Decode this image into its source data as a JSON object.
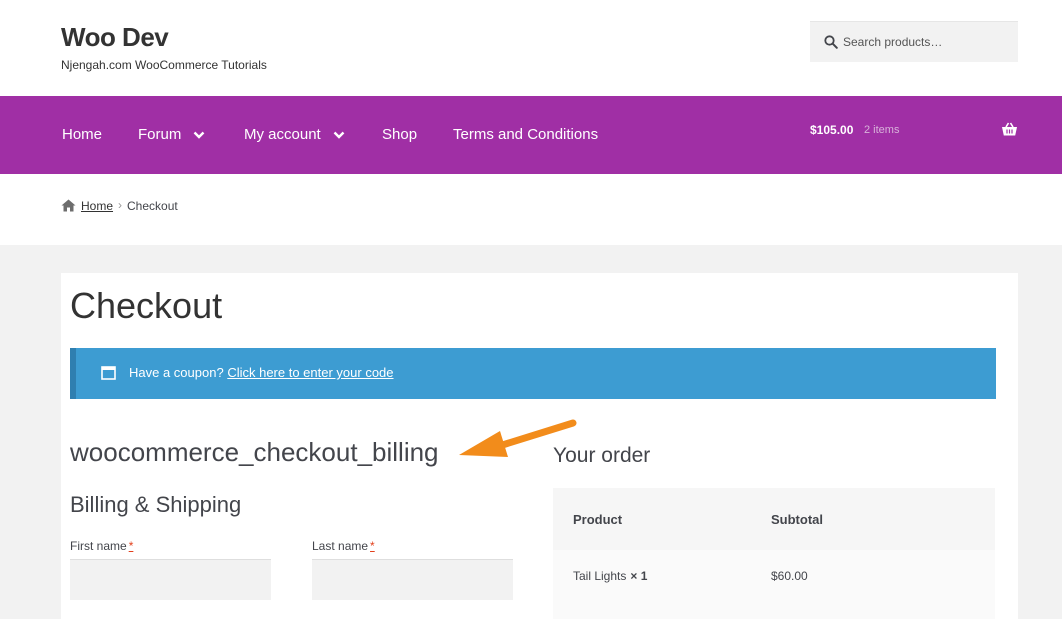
{
  "site": {
    "title": "Woo Dev",
    "description": "Njengah.com WooCommerce Tutorials"
  },
  "search": {
    "placeholder": "Search products…"
  },
  "nav": {
    "items": [
      {
        "label": "Home",
        "has_dropdown": false
      },
      {
        "label": "Forum",
        "has_dropdown": true
      },
      {
        "label": "My account",
        "has_dropdown": true
      },
      {
        "label": "Shop",
        "has_dropdown": false
      },
      {
        "label": "Terms and Conditions",
        "has_dropdown": false
      }
    ]
  },
  "cart": {
    "total": "$105.00",
    "count": "2 items"
  },
  "breadcrumb": {
    "home": "Home",
    "separator": "›",
    "current": "Checkout"
  },
  "page": {
    "title": "Checkout"
  },
  "coupon": {
    "prompt": "Have a coupon?",
    "link": "Click here to enter your code"
  },
  "checkout": {
    "hook_title": "woocommerce_checkout_billing",
    "billing_title": "Billing & Shipping",
    "first_name_label": "First name",
    "last_name_label": "Last name",
    "required_mark": "*"
  },
  "order": {
    "title": "Your order",
    "columns": [
      "Product",
      "Subtotal"
    ],
    "rows": [
      {
        "product": "Tail Lights",
        "qty": "× 1",
        "subtotal": "$60.00"
      }
    ]
  },
  "colors": {
    "nav_background": "#a02fa5",
    "notice_background": "#3d9cd2",
    "annotation_arrow": "#f28c1b",
    "required": "#e2401c"
  }
}
